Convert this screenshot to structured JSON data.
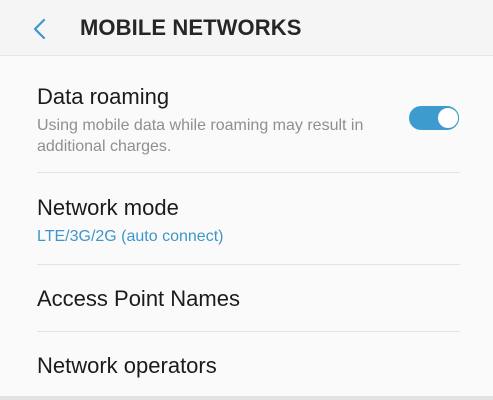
{
  "header": {
    "title": "MOBILE NETWORKS",
    "back_icon": "chevron-left-icon"
  },
  "colors": {
    "accent": "#3d97c9",
    "toggle_on": "#3d9ccd",
    "title_text": "#1b1b1b",
    "secondary_text": "#8f8f8f"
  },
  "settings": {
    "data_roaming": {
      "title": "Data roaming",
      "subtitle": "Using mobile data while roaming may result in additional charges.",
      "enabled": true
    },
    "network_mode": {
      "title": "Network mode",
      "value": "LTE/3G/2G (auto connect)"
    },
    "access_point_names": {
      "title": "Access Point Names"
    },
    "network_operators": {
      "title": "Network operators"
    }
  }
}
